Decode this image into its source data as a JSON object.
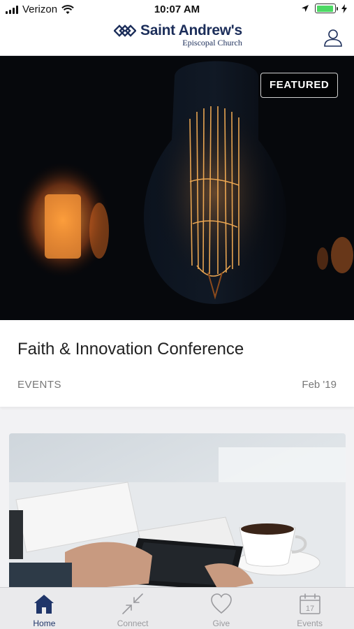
{
  "status_bar": {
    "carrier": "Verizon",
    "time": "10:07 AM",
    "battery_level": 0.95
  },
  "header": {
    "logo_name": "Saint Andrew's",
    "logo_subtitle": "Episcopal Church"
  },
  "featured": {
    "badge": "FEATURED",
    "title": "Faith & Innovation Conference",
    "category": "EVENTS",
    "date": "Feb '19"
  },
  "tabs": [
    {
      "label": "Home",
      "icon": "home-icon",
      "active": true
    },
    {
      "label": "Connect",
      "icon": "connect-icon",
      "active": false
    },
    {
      "label": "Give",
      "icon": "heart-icon",
      "active": false
    },
    {
      "label": "Events",
      "icon": "calendar-icon",
      "active": false,
      "icon_text": "17"
    }
  ],
  "colors": {
    "brand": "#1c2e5a",
    "tab_active": "#1f3569",
    "tab_inactive": "#9a9a9e",
    "battery": "#4cd964"
  }
}
